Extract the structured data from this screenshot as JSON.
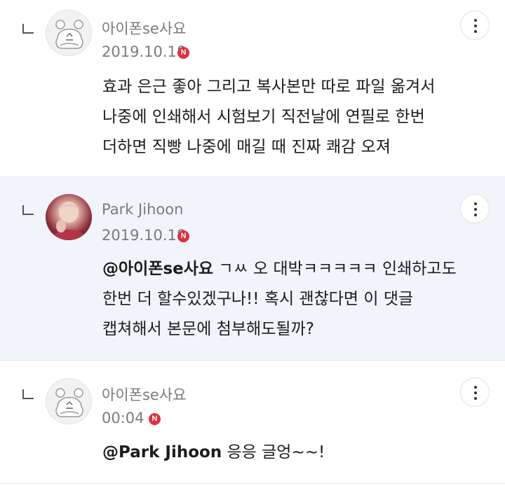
{
  "comments": [
    {
      "nickname": "아이폰se사요",
      "date": "2019.10.18",
      "badge": "N",
      "avatar_icon": "sheep-avatar-icon",
      "lines": [
        "효과 은근 좋아 그리고 복사본만 따로 파일 옮겨서",
        "나중에 인쇄해서 시험보기 직전날에 연필로 한번",
        "더하면 직빵 나중에 매길 때 진짜 쾌감 오져"
      ]
    },
    {
      "nickname": "Park Jihoon",
      "date": "2019.10.18",
      "badge": "N",
      "avatar_icon": "profile-photo-avatar",
      "mention": "@아이폰se사요",
      "lines": [
        " ㄱㅆ 오 대박ㅋㅋㅋㅋㅋ 인쇄하고도",
        "한번 더 할수있겠구나!! 혹시 괜찮다면 이 댓글",
        "캡쳐해서 본문에 첨부해도될까?"
      ]
    },
    {
      "nickname": "아이폰se사요",
      "date": "00:04",
      "badge": "N",
      "avatar_icon": "sheep-avatar-icon",
      "mention": "@Park Jihoon",
      "lines": [
        " 응응 글엉~~!"
      ]
    }
  ],
  "colors": {
    "highlight_bg": "#f1f4fa",
    "badge": "#e0303a",
    "meta_text": "#7b7b7b"
  },
  "icons": {
    "reply": "reply-arrow-icon",
    "more": "more-vertical-icon"
  }
}
